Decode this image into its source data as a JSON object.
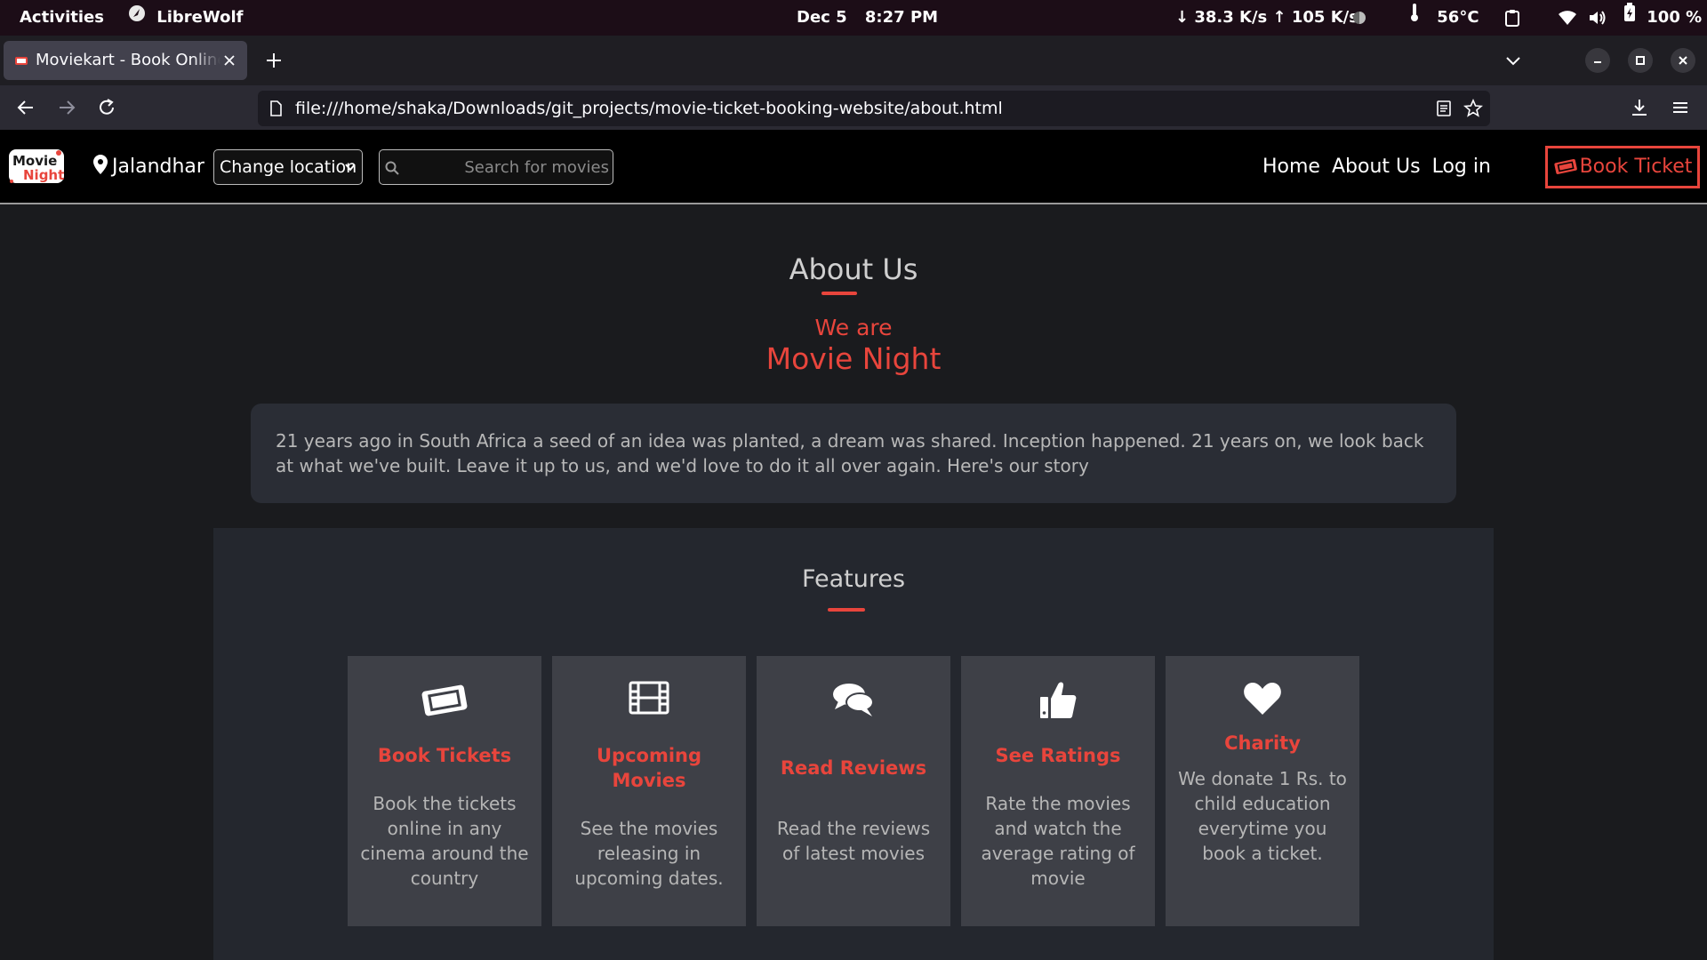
{
  "system_bar": {
    "activities": "Activities",
    "app_name": "LibreWolf",
    "date": "Dec 5",
    "time": "8:27 PM",
    "net_speed": "↓ 38.3 K/s ↑ 105 K/s",
    "temperature": "56°C",
    "battery": "100 %"
  },
  "browser": {
    "tab_title": "Moviekart - Book Online Movie Tickets",
    "url": "file:///home/shaka/Downloads/git_projects/movie-ticket-booking-website/about.html"
  },
  "site_header": {
    "logo_text": "Movie Night",
    "location": "Jalandhar",
    "change_location": "Change location",
    "search_placeholder": "Search for movies",
    "nav_home": "Home",
    "nav_about": "About Us",
    "nav_login": "Log in",
    "book_ticket": "Book Ticket"
  },
  "about": {
    "title": "About Us",
    "we_are": "We are",
    "brand": "Movie Night",
    "story": "21 years ago in South Africa a seed of an idea was planted, a dream was shared. Inception happened. 21 years on, we look back at what we've built. Leave it up to us, and we'd love to do it all over again. Here's our story"
  },
  "features": {
    "title": "Features",
    "cards": [
      {
        "icon": "ticket-icon",
        "title": "Book Tickets",
        "desc": "Book the tickets online in any cinema around the country"
      },
      {
        "icon": "film-icon",
        "title": "Upcoming Movies",
        "desc": "See the movies releasing in upcoming dates."
      },
      {
        "icon": "comments-icon",
        "title": "Read Reviews",
        "desc": "Read the reviews of latest movies"
      },
      {
        "icon": "thumbs-up-icon",
        "title": "See Ratings",
        "desc": "Rate the movies and watch the average rating of movie"
      },
      {
        "icon": "heart-icon",
        "title": "Charity",
        "desc": "We donate 1 Rs. to child education everytime you book a ticket."
      }
    ]
  },
  "colors": {
    "accent": "#e8453c",
    "page_bg": "#1a1b1e",
    "card_bg": "#3e4047",
    "section_bg": "#24272e"
  }
}
